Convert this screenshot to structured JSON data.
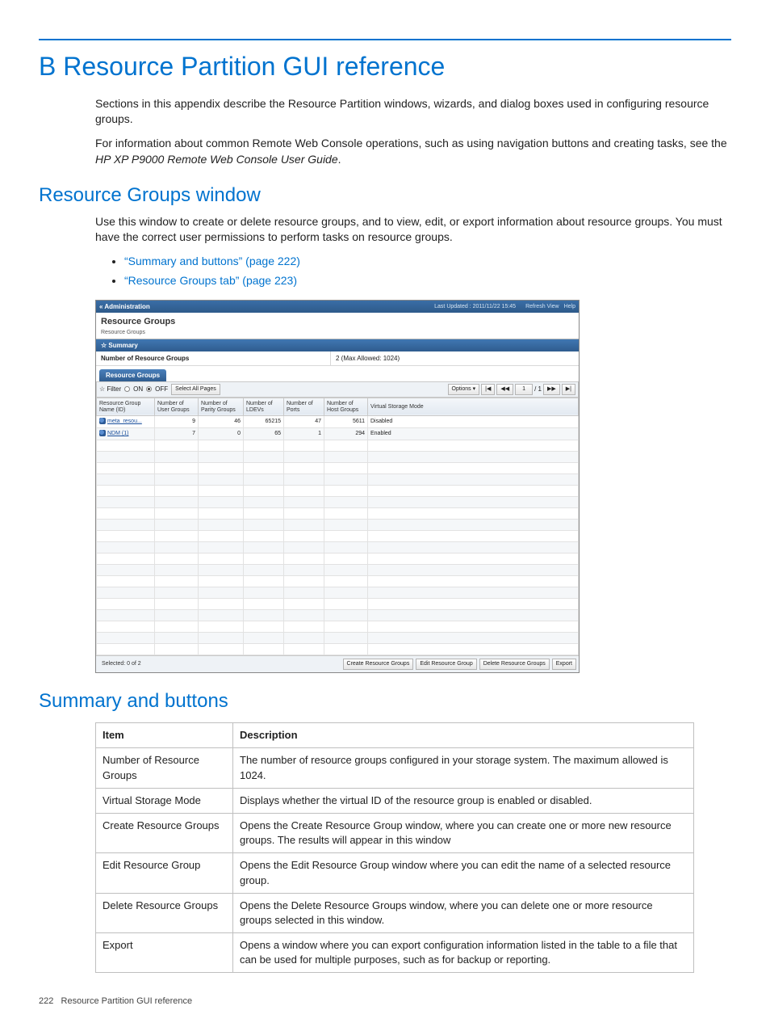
{
  "page": {
    "title": "B Resource Partition GUI reference",
    "intro1": "Sections in this appendix describe the Resource Partition windows, wizards, and dialog boxes used in configuring resource groups.",
    "intro2a": "For information about common Remote Web Console operations, such as using navigation buttons and creating tasks, see the ",
    "intro2b": "HP XP P9000 Remote Web Console User Guide",
    "intro2c": ".",
    "h2_window": "Resource Groups window",
    "window_intro": "Use this window to create or delete resource groups, and to view, edit, or export information about resource groups. You must have the correct user permissions to perform tasks on resource groups.",
    "links": [
      "“Summary and buttons” (page 222)",
      "“Resource Groups tab” (page 223)"
    ],
    "h2_summary": "Summary and buttons",
    "footer_num": "222",
    "footer_text": "Resource Partition GUI reference"
  },
  "mock": {
    "admin_label": "« Administration",
    "last_updated": "Last Updated : 2011/11/22 15:45",
    "refresh": "Refresh View",
    "help": "Help",
    "panel_title": "Resource Groups",
    "breadcrumb": "Resource Groups",
    "summary_header": "☆  Summary",
    "num_label": "Number of Resource Groups",
    "num_value": "2 (Max Allowed: 1024)",
    "tab": "Resource Groups",
    "filter_label": "☆ Filter",
    "on": "ON",
    "off": "OFF",
    "select_all": "Select All Pages",
    "options": "Options ▾",
    "nav_first": "|◀",
    "nav_prev": "◀◀",
    "page_current": "1",
    "page_sep": "/ 1",
    "nav_next": "▶▶",
    "nav_last": "▶|",
    "headers": [
      "Resource Group Name (ID)",
      "Number of User Groups",
      "Number of Parity Groups",
      "Number of LDEVs",
      "Number of Ports",
      "Number of Host Groups",
      "Virtual Storage Mode"
    ],
    "rows": [
      {
        "name": "meta_resou...",
        "ug": "9",
        "pg": "46",
        "ld": "65215",
        "ports": "47",
        "hg": "5611",
        "vsm": "Disabled"
      },
      {
        "name": "NDM (1)",
        "ug": "7",
        "pg": "0",
        "ld": "65",
        "ports": "1",
        "hg": "294",
        "vsm": "Enabled"
      }
    ],
    "selected": "Selected:  0   of  2",
    "btn_create": "Create Resource Groups",
    "btn_edit": "Edit Resource Group",
    "btn_delete": "Delete Resource Groups",
    "btn_export": "Export"
  },
  "desc": {
    "h_item": "Item",
    "h_description": "Description",
    "rows": [
      {
        "item": "Number of Resource Groups",
        "desc": "The number of resource groups configured in your storage system. The maximum allowed is 1024."
      },
      {
        "item": "Virtual Storage Mode",
        "desc": "Displays whether the virtual ID of the resource group is enabled or disabled."
      },
      {
        "item": "Create Resource Groups",
        "desc": "Opens the Create Resource Group window, where you can create one or more new resource groups. The results will appear in this window"
      },
      {
        "item": "Edit Resource Group",
        "desc": "Opens the Edit Resource Group window where you can edit the name of a selected resource group."
      },
      {
        "item": "Delete Resource Groups",
        "desc": "Opens the Delete Resource Groups window, where you can delete one or more resource groups selected in this window."
      },
      {
        "item": "Export",
        "desc": "Opens a window where you can export configuration information listed in the table to a file that can be used for multiple purposes, such as for backup or reporting."
      }
    ]
  }
}
